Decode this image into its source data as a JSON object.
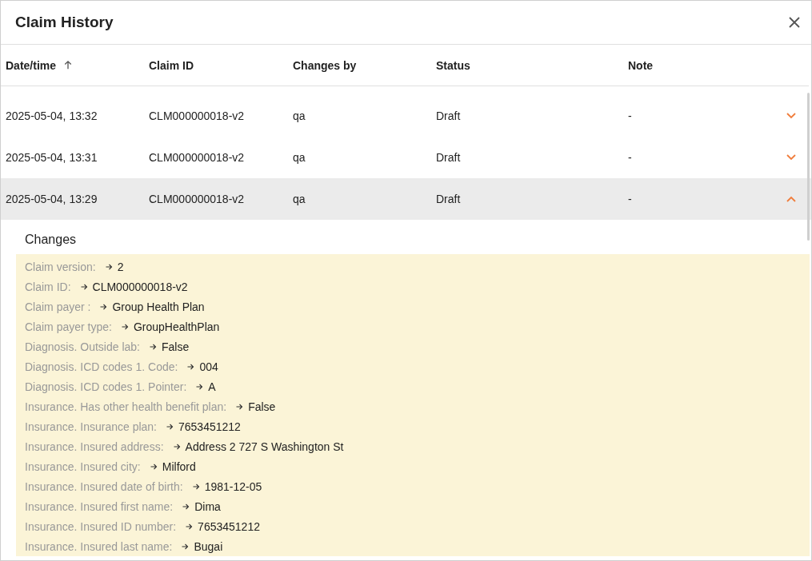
{
  "dialog": {
    "title": "Claim History"
  },
  "table": {
    "columns": [
      {
        "label": "Date/time",
        "sorted": true
      },
      {
        "label": "Claim ID",
        "sorted": false
      },
      {
        "label": "Changes by",
        "sorted": false
      },
      {
        "label": "Status",
        "sorted": false
      },
      {
        "label": "Note",
        "sorted": false
      }
    ],
    "rows": [
      {
        "cells": [
          "2025-05-04, 13:32",
          "CLM000000018-v2",
          "qa",
          "Draft",
          "-"
        ],
        "expanded": false
      },
      {
        "cells": [
          "2025-05-04, 13:31",
          "CLM000000018-v2",
          "qa",
          "Draft",
          "-"
        ],
        "expanded": false
      },
      {
        "cells": [
          "2025-05-04, 13:29",
          "CLM000000018-v2",
          "qa",
          "Draft",
          "-"
        ],
        "expanded": true,
        "changes": {
          "title": "Changes",
          "items": [
            {
              "field": "Claim version:",
              "value": "2"
            },
            {
              "field": "Claim ID:",
              "value": "CLM000000018-v2"
            },
            {
              "field": "Claim payer :",
              "value": "Group Health Plan"
            },
            {
              "field": "Claim payer type:",
              "value": "GroupHealthPlan"
            },
            {
              "field": "Diagnosis. Outside lab:",
              "value": "False"
            },
            {
              "field": "Diagnosis. ICD codes 1. Code:",
              "value": "004"
            },
            {
              "field": "Diagnosis. ICD codes 1. Pointer:",
              "value": "A"
            },
            {
              "field": "Insurance. Has other health benefit plan:",
              "value": "False"
            },
            {
              "field": "Insurance. Insurance plan:",
              "value": "7653451212"
            },
            {
              "field": "Insurance. Insured address:",
              "value": "Address 2 727 S Washington St"
            },
            {
              "field": "Insurance. Insured city:",
              "value": "Milford"
            },
            {
              "field": "Insurance. Insured date of birth:",
              "value": "1981-12-05"
            },
            {
              "field": "Insurance. Insured first name:",
              "value": "Dima"
            },
            {
              "field": "Insurance. Insured ID number:",
              "value": "7653451212"
            },
            {
              "field": "Insurance. Insured last name:",
              "value": "Bugai"
            }
          ]
        }
      }
    ]
  }
}
